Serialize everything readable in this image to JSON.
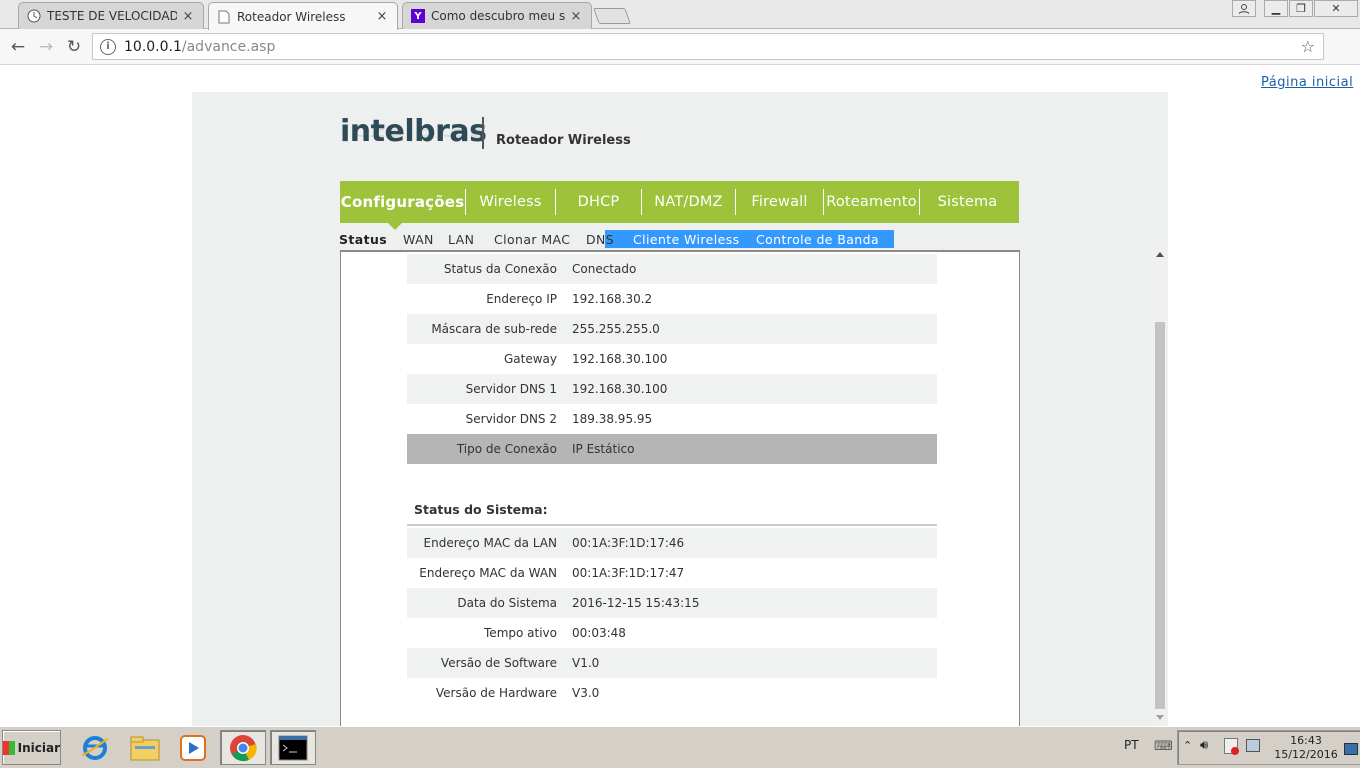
{
  "browser": {
    "tabs": [
      {
        "title": "TESTE DE VELOCIDADE da I",
        "icon": "clock-icon"
      },
      {
        "title": "Roteador Wireless",
        "icon": "page-icon"
      },
      {
        "title": "Como descubro meu servid",
        "icon": "yahoo-icon"
      }
    ],
    "url_host": "10.0.0.1",
    "url_path": "/advance.asp"
  },
  "page": {
    "home_link": "Página inicial",
    "logo": "intelbras",
    "product": "Roteador Wireless",
    "main_nav": [
      "Configurações",
      "Wireless",
      "DHCP",
      "NAT/DMZ",
      "Firewall",
      "Roteamento",
      "Sistema"
    ],
    "sub_nav": [
      "Status",
      "WAN",
      "LAN",
      "Clonar MAC",
      "DNS",
      "Cliente Wireless",
      "Controle de Banda"
    ],
    "connection_rows": [
      {
        "label": "Status da Conexão",
        "value": "Conectado"
      },
      {
        "label": "Endereço IP",
        "value": "192.168.30.2"
      },
      {
        "label": "Máscara de sub-rede",
        "value": "255.255.255.0"
      },
      {
        "label": "Gateway",
        "value": "192.168.30.100"
      },
      {
        "label": "Servidor DNS 1",
        "value": "192.168.30.100"
      },
      {
        "label": "Servidor DNS 2",
        "value": "189.38.95.95"
      },
      {
        "label": "Tipo de Conexão",
        "value": "IP Estático"
      }
    ],
    "system_heading": "Status do Sistema:",
    "system_rows": [
      {
        "label": "Endereço MAC da LAN",
        "value": "00:1A:3F:1D:17:46"
      },
      {
        "label": "Endereço MAC da WAN",
        "value": "00:1A:3F:1D:17:47"
      },
      {
        "label": "Data do Sistema",
        "value": "2016-12-15 15:43:15"
      },
      {
        "label": "Tempo ativo",
        "value": "00:03:48"
      },
      {
        "label": "Versão de Software",
        "value": "V1.0"
      },
      {
        "label": "Versão de Hardware",
        "value": "V3.0"
      }
    ]
  },
  "taskbar": {
    "start": "Iniciar",
    "lang": "PT",
    "time": "16:43",
    "date": "15/12/2016"
  },
  "colors": {
    "nav_green": "#9cc33a",
    "selection": "#3399ff",
    "logo": "#2d4a56"
  }
}
